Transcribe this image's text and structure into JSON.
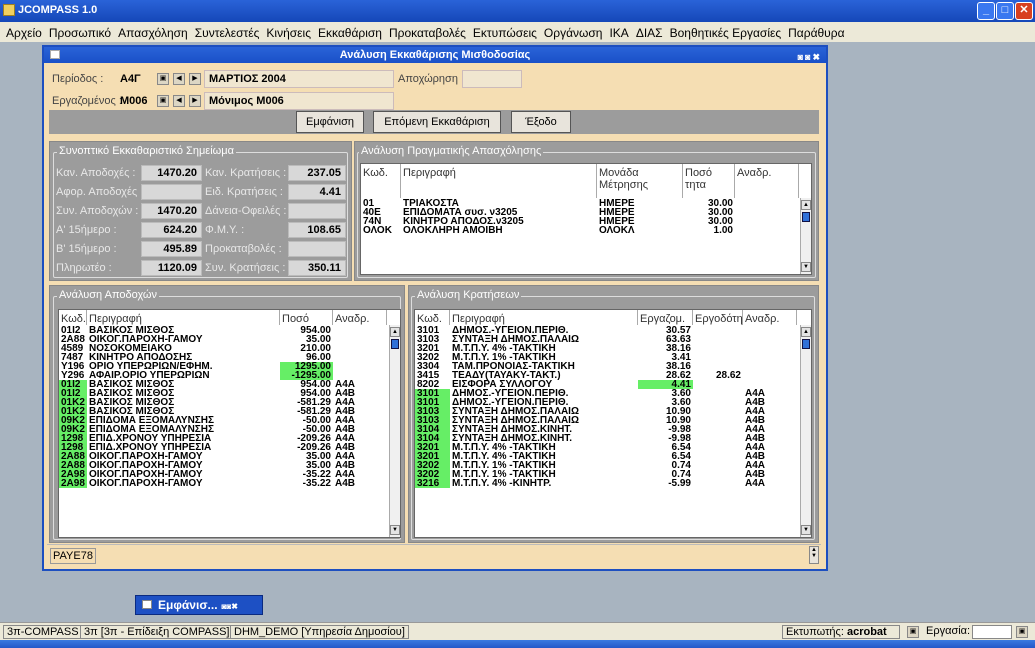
{
  "app": {
    "title": "JCOMPASS 1.0"
  },
  "menu": [
    "Αρχείο",
    "Προσωπικό",
    "Απασχόληση",
    "Συντελεστές",
    "Κινήσεις",
    "Εκκαθάριση",
    "Προκαταβολές",
    "Εκτυπώσεις",
    "Οργάνωση",
    "ΙΚΑ",
    "ΔΙΑΣ",
    "Βοηθητικές Εργασίες",
    "Παράθυρα"
  ],
  "window": {
    "title": "Ανάλυση Εκκαθάρισης Μισθοδοσίας"
  },
  "header": {
    "period_label": "Περίοδος :",
    "period_code": "Α4Γ",
    "period_value": "ΜΑΡΤΙΟΣ     2004",
    "employee_label": "Εργαζομένος :",
    "employee_code": "Μ006",
    "employee_value": "Μόνιμος Μ006",
    "departure_label": "Αποχώρηση :"
  },
  "buttons": {
    "show": "Εμφάνιση",
    "next": "Επόμενη Εκκαθάριση",
    "exit": "Έξοδο"
  },
  "summary": {
    "title": "Συνοπτικό Εκκαθαριστικό Σημείωμα",
    "left": [
      {
        "label": "Καν. Αποδοχές :",
        "value": "1470.20"
      },
      {
        "label": "Αφορ. Αποδοχές :",
        "value": ""
      },
      {
        "label": "Συν. Αποδοχών :",
        "value": "1470.20"
      },
      {
        "label": "Α' 15ήμερο :",
        "value": "624.20"
      },
      {
        "label": "Β' 15ήμερο :",
        "value": "495.89"
      },
      {
        "label": "Πληρωτέο :",
        "value": "1120.09"
      }
    ],
    "right": [
      {
        "label": "Καν. Κρατήσεις :",
        "value": "237.05"
      },
      {
        "label": "Ειδ. Κρατήσεις :",
        "value": "4.41"
      },
      {
        "label": "Δάνεια-Οφειλές :",
        "value": ""
      },
      {
        "label": "Φ.Μ.Υ. :",
        "value": "108.65"
      },
      {
        "label": "Προκαταβολές :",
        "value": ""
      },
      {
        "label": "Συν. Κρατήσεις :",
        "value": "350.11"
      }
    ]
  },
  "employment": {
    "title": "Ανάλυση Πραγματικής Απασχόλησης",
    "headers": [
      "Κωδ.",
      "Περιγραφή",
      "Μονάδα Μέτρησης",
      "Ποσό τητα",
      "Αναδρ."
    ],
    "rows": [
      [
        "01",
        "ΤΡΙΑΚΟΣΤΑ",
        "ΗΜΕΡΕ",
        "30.00",
        ""
      ],
      [
        "40Ε",
        "ΕΠΙΔΟΜΑΤΑ συσ. ν3205",
        "ΗΜΕΡΕ",
        "30.00",
        ""
      ],
      [
        "74Ν",
        "ΚΙΝΗΤΡΟ ΑΠΟΔΟΣ.ν3205",
        "ΗΜΕΡΕ",
        "30.00",
        ""
      ],
      [
        "ΟΛΟΚ",
        "ΟΛΟΚΛΗΡΗ ΑΜΟΙΒΗ",
        "ΟΛΟΚΛ",
        "1.00",
        ""
      ]
    ]
  },
  "earnings": {
    "title": "Ανάλυση Αποδοχών",
    "headers": [
      "Κωδ.",
      "Περιγραφή",
      "Ποσό",
      "Αναδρ."
    ],
    "rows": [
      [
        "01Ι2",
        "ΒΑΣΙΚΟΣ ΜΙΣΘΟΣ",
        "954.00",
        "",
        ""
      ],
      [
        "2Α88",
        "ΟΙΚΟΓ.ΠΑΡΟΧΗ-ΓΑΜΟΥ",
        "35.00",
        "",
        ""
      ],
      [
        "4589",
        "ΝΟΣΟΚΟΜΕΙΑΚΟ",
        "210.00",
        "",
        ""
      ],
      [
        "7487",
        "ΚΙΝΗΤΡΟ ΑΠΟΔΟΣΗΣ",
        "96.00",
        "",
        ""
      ],
      [
        "Υ196",
        "ΟΡΙΟ ΥΠΕΡΩΡΙΩΝ/ΕΦΗΜ.",
        "1295.00",
        "",
        "v"
      ],
      [
        "Υ296",
        "ΑΦΑΙΡ.ΟΡΙΟ ΥΠΕΡΩΡΙΩΝ",
        "-1295.00",
        "",
        "v"
      ],
      [
        "01Ι2",
        "ΒΑΣΙΚΟΣ ΜΙΣΘΟΣ",
        "954.00",
        "Α4Α",
        "c"
      ],
      [
        "01Ι2",
        "ΒΑΣΙΚΟΣ ΜΙΣΘΟΣ",
        "954.00",
        "Α4Β",
        "c"
      ],
      [
        "01Κ2",
        "ΒΑΣΙΚΟΣ ΜΙΣΘΟΣ",
        "-581.29",
        "Α4Α",
        "c"
      ],
      [
        "01Κ2",
        "ΒΑΣΙΚΟΣ ΜΙΣΘΟΣ",
        "-581.29",
        "Α4Β",
        "c"
      ],
      [
        "09Κ2",
        "ΕΠΙΔΟΜΑ ΕΞΟΜΑΛΥΝΣΗΣ",
        "-50.00",
        "Α4Α",
        "c"
      ],
      [
        "09Κ2",
        "ΕΠΙΔΟΜΑ ΕΞΟΜΑΛΥΝΣΗΣ",
        "-50.00",
        "Α4Β",
        "c"
      ],
      [
        "1298",
        "ΕΠΙΔ.ΧΡΟΝΟΥ ΥΠΗΡΕΣΙΑ",
        "-209.26",
        "Α4Α",
        "c"
      ],
      [
        "1298",
        "ΕΠΙΔ.ΧΡΟΝΟΥ ΥΠΗΡΕΣΙΑ",
        "-209.26",
        "Α4Β",
        "c"
      ],
      [
        "2Α88",
        "ΟΙΚΟΓ.ΠΑΡΟΧΗ-ΓΑΜΟΥ",
        "35.00",
        "Α4Α",
        "c"
      ],
      [
        "2Α88",
        "ΟΙΚΟΓ.ΠΑΡΟΧΗ-ΓΑΜΟΥ",
        "35.00",
        "Α4Β",
        "c"
      ],
      [
        "2Α98",
        "ΟΙΚΟΓ.ΠΑΡΟΧΗ-ΓΑΜΟΥ",
        "-35.22",
        "Α4Α",
        "c"
      ],
      [
        "2Α98",
        "ΟΙΚΟΓ.ΠΑΡΟΧΗ-ΓΑΜΟΥ",
        "-35.22",
        "Α4Β",
        "c"
      ]
    ]
  },
  "deductions": {
    "title": "Ανάλυση Κρατήσεων",
    "headers": [
      "Κωδ.",
      "Περιγραφή",
      "Εργαζομ.",
      "Εργοδότη",
      "Αναδρ."
    ],
    "rows": [
      [
        "3101",
        "ΔΗΜΟΣ.-ΥΓΕΙΟΝ.ΠΕΡΙΘ.",
        "30.57",
        "",
        "",
        ""
      ],
      [
        "3103",
        "ΣΥΝΤΑΞΗ ΔΗΜΟΣ.ΠΑΛΑΙΩ",
        "63.63",
        "",
        "",
        ""
      ],
      [
        "3201",
        "Μ.Τ.Π.Υ. 4% -ΤΑΚΤΙΚΗ",
        "38.16",
        "",
        "",
        ""
      ],
      [
        "3202",
        "Μ.Τ.Π.Υ. 1% -ΤΑΚΤΙΚΗ",
        "3.41",
        "",
        "",
        ""
      ],
      [
        "3304",
        "ΤΑΜ.ΠΡΟΝΟΙΑΣ-ΤΑΚΤΙΚΗ",
        "38.16",
        "",
        "",
        ""
      ],
      [
        "3415",
        "ΤΕΑΔΥ(ΤΑΥΑΚΥ-ΤΑΚΤ.)",
        "28.62",
        "28.62",
        "",
        ""
      ],
      [
        "8202",
        "ΕΙΣΦΟΡΑ ΣΥΛΛΟΓΟΥ",
        "4.41",
        "",
        "",
        "v"
      ],
      [
        "3101",
        "ΔΗΜΟΣ.-ΥΓΕΙΟΝ.ΠΕΡΙΘ.",
        "3.60",
        "",
        "Α4Α",
        "c"
      ],
      [
        "3101",
        "ΔΗΜΟΣ.-ΥΓΕΙΟΝ.ΠΕΡΙΘ.",
        "3.60",
        "",
        "Α4Β",
        "c"
      ],
      [
        "3103",
        "ΣΥΝΤΑΞΗ ΔΗΜΟΣ.ΠΑΛΑΙΩ",
        "10.90",
        "",
        "Α4Α",
        "c"
      ],
      [
        "3103",
        "ΣΥΝΤΑΞΗ ΔΗΜΟΣ.ΠΑΛΑΙΩ",
        "10.90",
        "",
        "Α4Β",
        "c"
      ],
      [
        "3104",
        "ΣΥΝΤΑΞΗ ΔΗΜΟΣ.ΚΙΝΗΤ.",
        "-9.98",
        "",
        "Α4Α",
        "c"
      ],
      [
        "3104",
        "ΣΥΝΤΑΞΗ ΔΗΜΟΣ.ΚΙΝΗΤ.",
        "-9.98",
        "",
        "Α4Β",
        "c"
      ],
      [
        "3201",
        "Μ.Τ.Π.Υ. 4% -ΤΑΚΤΙΚΗ",
        "6.54",
        "",
        "Α4Α",
        "c"
      ],
      [
        "3201",
        "Μ.Τ.Π.Υ. 4% -ΤΑΚΤΙΚΗ",
        "6.54",
        "",
        "Α4Β",
        "c"
      ],
      [
        "3202",
        "Μ.Τ.Π.Υ. 1% -ΤΑΚΤΙΚΗ",
        "0.74",
        "",
        "Α4Α",
        "c"
      ],
      [
        "3202",
        "Μ.Τ.Π.Υ. 1% -ΤΑΚΤΙΚΗ",
        "0.74",
        "",
        "Α4Β",
        "c"
      ],
      [
        "3216",
        "Μ.Τ.Π.Υ. 4% -ΚΙΝΗΤΡ.",
        "-5.99",
        "",
        "Α4Α",
        "c"
      ]
    ]
  },
  "form_code": "PAYE78",
  "minimized": {
    "title": "Εμφάνισ..."
  },
  "statusbar": {
    "c1": "3π-COMPASS",
    "c2": "3π [3π - Επίδειξη COMPASS]",
    "c3": "DHM_DEMO [Υπηρεσία Δημοσίου]",
    "printer_label": "Εκτυπωτής:",
    "printer": "acrobat",
    "job_label": "Εργασία:"
  },
  "colors": {
    "highlight": "#66ee66",
    "title": "#1d4fc0"
  }
}
